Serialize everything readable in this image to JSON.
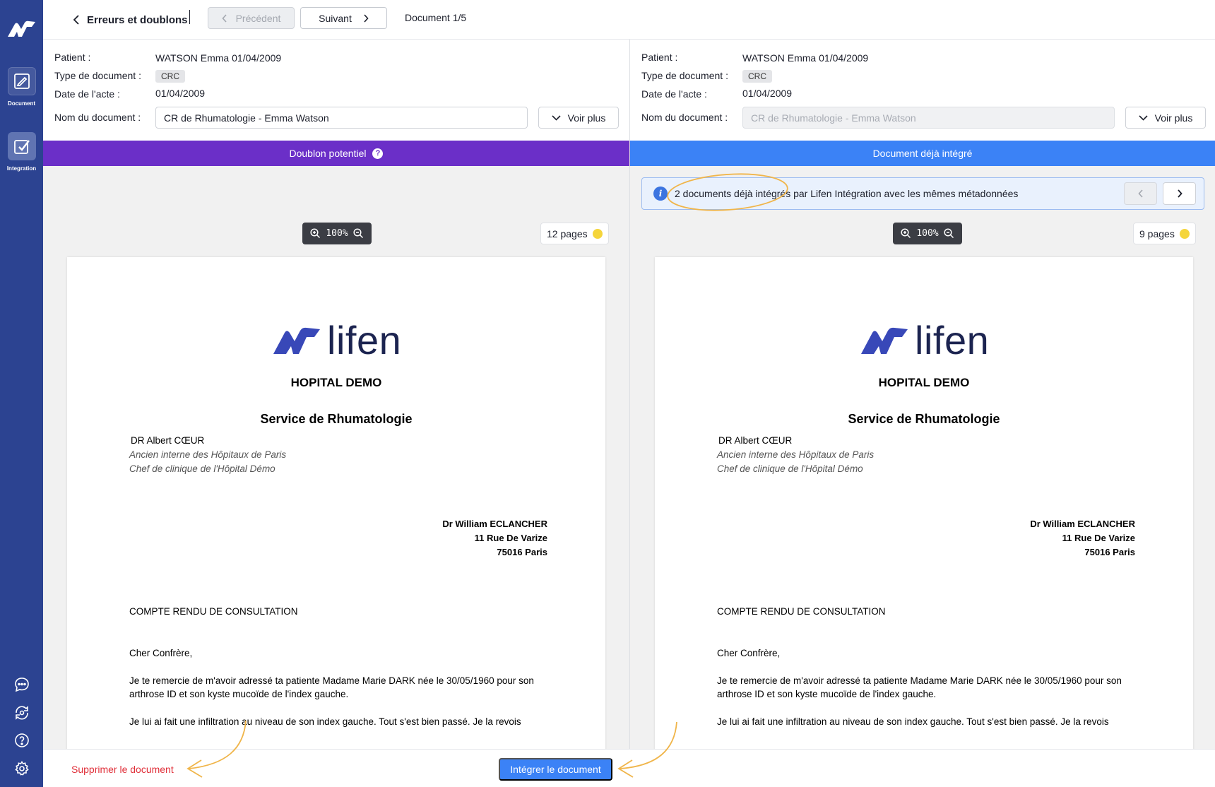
{
  "sidebar": {
    "items": [
      {
        "label": "Document",
        "icon": "edit-document-icon"
      },
      {
        "label": "Integration",
        "icon": "integration-icon"
      }
    ],
    "bottom_icons": [
      "chat-icon",
      "sync-icon",
      "help-icon",
      "settings-icon"
    ]
  },
  "topbar": {
    "back_label": "Erreurs et doublons",
    "prev_label": "Précédent",
    "next_label": "Suivant",
    "counter": "Document 1/5"
  },
  "labels": {
    "patient": "Patient :",
    "doc_type": "Type de document :",
    "act_date": "Date de l'acte :",
    "doc_name": "Nom du document :",
    "voir_plus": "Voir plus"
  },
  "left": {
    "patient_name": "WATSON Emma",
    "patient_dob": "01/04/2009",
    "doc_type": "CRC",
    "act_date": "01/04/2009",
    "doc_name": "CR de Rhumatologie - Emma Watson",
    "banner": "Doublon potentiel",
    "zoom": "100%",
    "pages": "12 pages"
  },
  "right": {
    "patient_name": "WATSON Emma",
    "patient_dob": "01/04/2009",
    "doc_type": "CRC",
    "act_date": "01/04/2009",
    "doc_name": "CR de Rhumatologie - Emma Watson",
    "banner": "Document déjà intégré",
    "info_text": "2 documents déjà intégrés par Lifen Intégration avec les mêmes métadonnées",
    "zoom": "100%",
    "pages": "9 pages"
  },
  "paper": {
    "logo_word": "lifen",
    "hospital": "HOPITAL DEMO",
    "service": "Service de Rhumatologie",
    "doctor": "DR Albert CŒUR",
    "doctor_line1": "Ancien interne des Hôpitaux de Paris",
    "doctor_line2": "Chef de clinique de l'Hôpital Démo",
    "recipient_name": "Dr William ECLANCHER",
    "recipient_street": "11 Rue De Varize",
    "recipient_city": "75016 Paris",
    "title": "COMPTE RENDU DE CONSULTATION",
    "greeting": "Cher Confrère,",
    "para1": "Je te remercie de m'avoir adressé ta patiente Madame Marie DARK née le 30/05/1960 pour son arthrose ID et son kyste mucoïde de l'index gauche.",
    "para2": "Je lui ai fait une infiltration au niveau de son index gauche. Tout s'est bien passé. Je la revois"
  },
  "actions": {
    "delete_label": "Supprimer le document",
    "integrate_label": "Intégrer le document"
  },
  "colors": {
    "sidebar": "#2c4391",
    "banner_duplicate": "#6b2fc8",
    "banner_integrated": "#3b82f6",
    "delete": "#e0303a",
    "annotation": "#f0b54a"
  }
}
